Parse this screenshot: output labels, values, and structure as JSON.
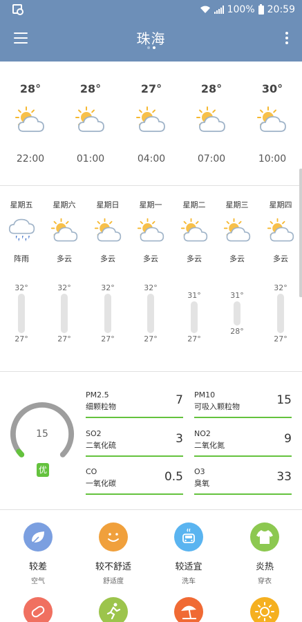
{
  "status_bar": {
    "battery": "100%",
    "time": "20:59"
  },
  "app_bar": {
    "title": "珠海"
  },
  "hourly": [
    {
      "temp": "28°",
      "time": "22:00",
      "icon": "partly-cloudy-icon"
    },
    {
      "temp": "28°",
      "time": "01:00",
      "icon": "partly-cloudy-icon"
    },
    {
      "temp": "27°",
      "time": "04:00",
      "icon": "partly-cloudy-icon"
    },
    {
      "temp": "28°",
      "time": "07:00",
      "icon": "partly-cloudy-icon"
    },
    {
      "temp": "30°",
      "time": "10:00",
      "icon": "partly-cloudy-icon"
    }
  ],
  "daily": [
    {
      "day": "星期五",
      "cond": "阵雨",
      "hi": "32°",
      "lo": "27°",
      "hi_val": 32,
      "lo_val": 27,
      "icon": "shower-icon"
    },
    {
      "day": "星期六",
      "cond": "多云",
      "hi": "32°",
      "lo": "27°",
      "hi_val": 32,
      "lo_val": 27,
      "icon": "partly-cloudy-icon"
    },
    {
      "day": "星期日",
      "cond": "多云",
      "hi": "32°",
      "lo": "27°",
      "hi_val": 32,
      "lo_val": 27,
      "icon": "partly-cloudy-icon"
    },
    {
      "day": "星期一",
      "cond": "多云",
      "hi": "32°",
      "lo": "27°",
      "hi_val": 32,
      "lo_val": 27,
      "icon": "partly-cloudy-icon"
    },
    {
      "day": "星期二",
      "cond": "多云",
      "hi": "31°",
      "lo": "27°",
      "hi_val": 31,
      "lo_val": 27,
      "icon": "partly-cloudy-icon"
    },
    {
      "day": "星期三",
      "cond": "多云",
      "hi": "31°",
      "lo": "28°",
      "hi_val": 31,
      "lo_val": 28,
      "icon": "partly-cloudy-icon"
    },
    {
      "day": "星期四",
      "cond": "多云",
      "hi": "32°",
      "lo": "27°",
      "hi_val": 32,
      "lo_val": 27,
      "icon": "partly-cloudy-icon"
    }
  ],
  "aqi": {
    "value": "15",
    "level": "优",
    "gauge_fraction": 0.03,
    "colors": {
      "good": "#64c23d",
      "track": "#9e9e9e"
    },
    "pollutants": [
      {
        "name": "PM2.5",
        "desc": "细颗粒物",
        "value": "7"
      },
      {
        "name": "PM10",
        "desc": "可吸入颗粒物",
        "value": "15"
      },
      {
        "name": "SO2",
        "desc": "二氧化硫",
        "value": "3"
      },
      {
        "name": "NO2",
        "desc": "二氧化氮",
        "value": "9"
      },
      {
        "name": "CO",
        "desc": "一氧化碳",
        "value": "0.5"
      },
      {
        "name": "O3",
        "desc": "臭氧",
        "value": "33"
      }
    ]
  },
  "life_index": [
    {
      "level": "较差",
      "label": "空气",
      "icon": "leaf-icon",
      "color": "#7b9fe0"
    },
    {
      "level": "较不舒适",
      "label": "舒适度",
      "icon": "smile-icon",
      "color": "#f0a03c"
    },
    {
      "level": "较适宜",
      "label": "洗车",
      "icon": "car-icon",
      "color": "#5ab4f0"
    },
    {
      "level": "炎热",
      "label": "穿衣",
      "icon": "shirt-icon",
      "color": "#8cc850"
    },
    {
      "icon": "pill-icon",
      "color": "#f07060"
    },
    {
      "icon": "running-icon",
      "color": "#9cc44c"
    },
    {
      "icon": "beach-umbrella-icon",
      "color": "#f06a34"
    },
    {
      "icon": "sun-icon",
      "color": "#f5b020"
    }
  ]
}
